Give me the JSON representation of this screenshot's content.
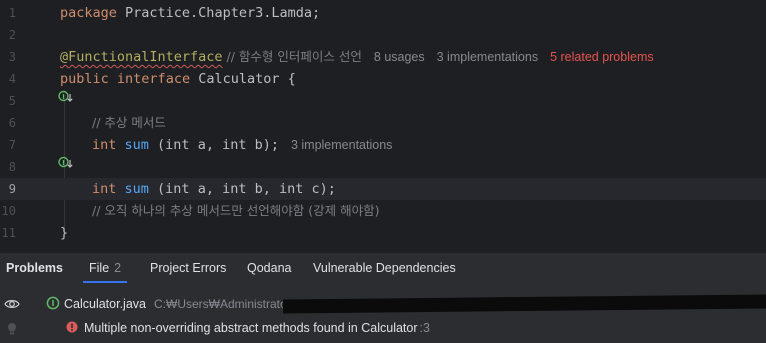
{
  "editor": {
    "lines": [
      {
        "n": "1",
        "tokens": [
          {
            "t": "package Practice.Chapter3.Lamda;",
            "c": "kw-pkg"
          }
        ]
      },
      {
        "n": "2",
        "tokens": []
      },
      {
        "n": "3",
        "annotation": "@FunctionalInterface",
        "comment": " // 함수형 인터페이스 선언",
        "hints": [
          "8 usages",
          "3 implementations"
        ],
        "error_hint": "5 related problems"
      },
      {
        "n": "4",
        "kw1": "public",
        "kw2": "interface",
        "name": "Calculator",
        "rest": " {"
      },
      {
        "n": "5"
      },
      {
        "n": "6",
        "comment": "// 추상 메서드"
      },
      {
        "n": "7",
        "kw": "int",
        "fn": "sum",
        "params": " (int a, int b);",
        "hint": "3 implementations"
      },
      {
        "n": "8"
      },
      {
        "n": "9",
        "kw": "int",
        "fn": "sum",
        "params": " (int a, int b, int c);"
      },
      {
        "n": "10",
        "comment": "// 오직 하나의 추상 메서드만 선언해야함 (강제 해야함)"
      },
      {
        "n": "11",
        "code": "}"
      }
    ],
    "package_kw": "package",
    "package_name": " Practice.Chapter3.Lamda;",
    "int_kw": "int",
    "brace_close": "}"
  },
  "problems_panel": {
    "title": "Problems",
    "tabs": [
      {
        "label": "File",
        "count": "2",
        "active": true
      },
      {
        "label": "Project Errors"
      },
      {
        "label": "Qodana"
      },
      {
        "label": "Vulnerable Dependencies"
      }
    ],
    "file_row": {
      "name": "Calculator.java",
      "path": "C:₩Users₩Administrator₩"
    },
    "error_row": {
      "message": "Multiple non-overriding abstract methods found in Calculator",
      "position": ":3"
    }
  },
  "colors": {
    "editor_bg": "#1e1f22",
    "keyword": "#cf8e6d",
    "function": "#56a8f5",
    "annotation": "#b3ae60",
    "comment": "#7a7e85",
    "error": "#e5544f",
    "accent": "#3574f0"
  },
  "icons": [
    "implemented-interface-icon",
    "eye-icon",
    "lightbulb-icon",
    "java-interface-icon",
    "error-icon"
  ]
}
